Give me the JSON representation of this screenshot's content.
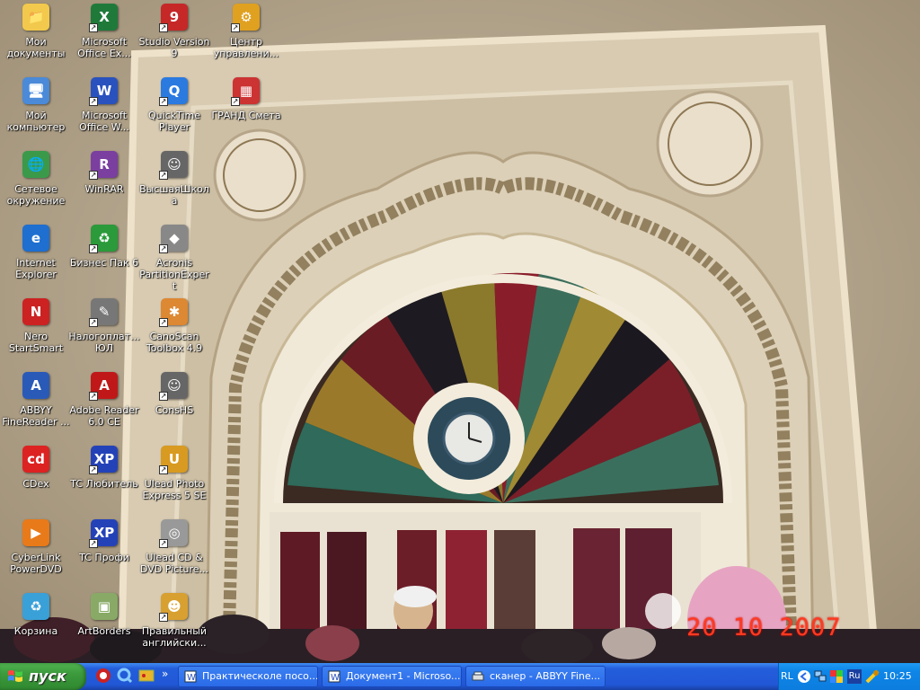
{
  "desktop": {
    "icons": [
      {
        "label": "Мои документы",
        "icon": "folder-documents-icon"
      },
      {
        "label": "Microsoft Office Ex...",
        "icon": "excel-icon"
      },
      {
        "label": "Studio Version 9",
        "icon": "studio-icon"
      },
      {
        "label": "Центр управлени...",
        "icon": "control-center-icon"
      },
      {
        "label": "Мой компьютер",
        "icon": "computer-icon"
      },
      {
        "label": "Microsoft Office W...",
        "icon": "word-icon"
      },
      {
        "label": "QuickTime Player",
        "icon": "quicktime-icon"
      },
      {
        "label": "ГРАНД Смета",
        "icon": "grand-smeta-icon"
      },
      {
        "label": "Сетевое окружение",
        "icon": "network-icon"
      },
      {
        "label": "WinRAR",
        "icon": "winrar-icon"
      },
      {
        "label": "ВысшаяШкола",
        "icon": "school-icon"
      },
      {
        "label": "Internet Explorer",
        "icon": "internet-explorer-icon"
      },
      {
        "label": "Бизнес Пак 6",
        "icon": "business-pack-icon"
      },
      {
        "label": "Acronis PartitionExpert",
        "icon": "acronis-icon"
      },
      {
        "label": "Nero StartSmart",
        "icon": "nero-icon"
      },
      {
        "label": "Налогоплат... ЮЛ",
        "icon": "tax-icon"
      },
      {
        "label": "CanoScan Toolbox 4.9",
        "icon": "canoscan-icon"
      },
      {
        "label": "ABBYY FineReader ...",
        "icon": "finereader-icon"
      },
      {
        "label": "Adobe Reader 6.0 CE",
        "icon": "adobe-reader-icon"
      },
      {
        "label": "ConsHS",
        "icon": "conshs-icon"
      },
      {
        "label": "CDex",
        "icon": "cdex-icon"
      },
      {
        "label": "TC Любитель",
        "icon": "tc-amateur-icon"
      },
      {
        "label": "Ulead Photo Express 5 SE",
        "icon": "ulead-photo-icon"
      },
      {
        "label": "CyberLink PowerDVD",
        "icon": "powerdvd-icon"
      },
      {
        "label": "TC Профи",
        "icon": "tc-pro-icon"
      },
      {
        "label": "Ulead CD & DVD Picture...",
        "icon": "ulead-cd-icon"
      },
      {
        "label": "Корзина",
        "icon": "recycle-bin-icon"
      },
      {
        "label": "ArtBorders",
        "icon": "artborders-icon"
      },
      {
        "label": "Правильный английски...",
        "icon": "english-icon"
      }
    ],
    "date_stamp": "20 10 2007"
  },
  "taskbar": {
    "start_label": "пуск",
    "quick_launch": [
      "opera-icon",
      "quicktime-quick-icon",
      "media-icon"
    ],
    "chevron": "»",
    "tasks": [
      {
        "label": "Практическоле посо...",
        "icon": "word-doc-icon"
      },
      {
        "label": "Документ1 - Microso...",
        "icon": "word-doc-icon"
      },
      {
        "label": "сканер - ABBYY Fine...",
        "icon": "scanner-icon"
      }
    ],
    "tray": {
      "lang": "RL",
      "lang_badge": "Ru",
      "time": "10:25"
    }
  },
  "colors": {
    "taskbar": "#245edb",
    "start": "#3c9a3c",
    "tray": "#0c7dde",
    "date_stamp": "#ff3a20"
  }
}
